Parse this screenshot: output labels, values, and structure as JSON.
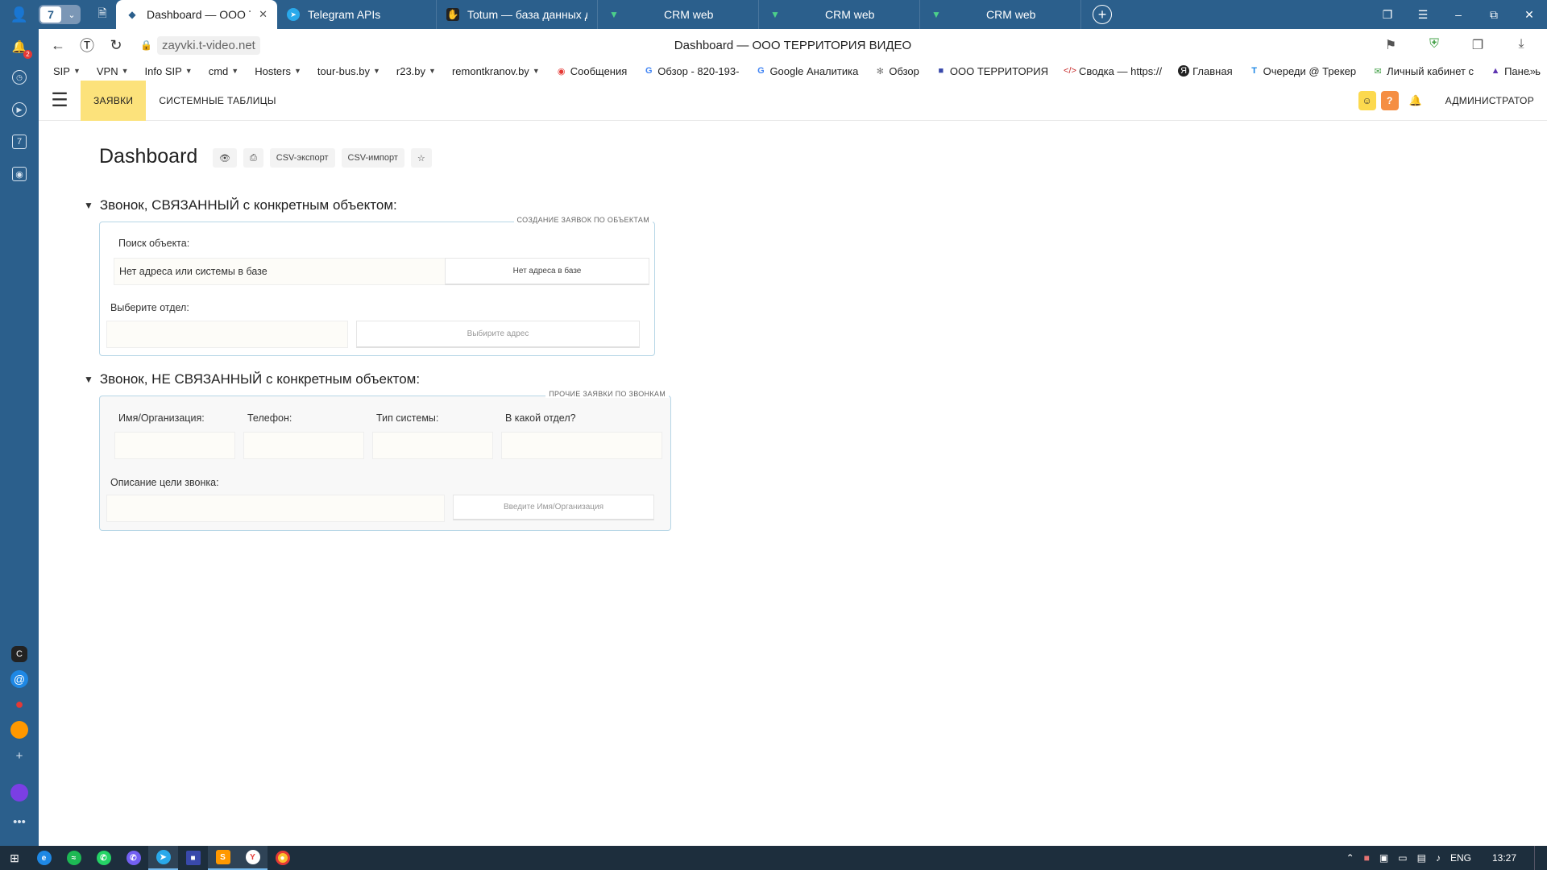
{
  "browser": {
    "tab_count": "7",
    "tabs": [
      {
        "label": "Dashboard — ООО ТЕРРИТОРИЯ ВИДЕО",
        "active": true
      },
      {
        "label": "Telegram APIs"
      },
      {
        "label": "Totum — база данных для бизнеса"
      },
      {
        "label": "CRM web"
      },
      {
        "label": "CRM web"
      },
      {
        "label": "CRM web"
      }
    ],
    "url": "zayvki.t-video.net",
    "page_title": "Dashboard — ООО ТЕРРИТОРИЯ ВИДЕО",
    "notification_count": "2",
    "sidebar_cal_day": "7",
    "sidebar_c_label": "C",
    "bookmarks": [
      {
        "label": "SIP",
        "dropdown": true
      },
      {
        "label": "VPN",
        "dropdown": true
      },
      {
        "label": "Info SIP",
        "dropdown": true
      },
      {
        "label": "cmd",
        "dropdown": true
      },
      {
        "label": "Hosters",
        "dropdown": true
      },
      {
        "label": "tour-bus.by",
        "dropdown": true
      },
      {
        "label": "r23.by",
        "dropdown": true
      },
      {
        "label": "remontkranov.by",
        "dropdown": true
      },
      {
        "label": "Сообщения",
        "icon": "mail-icon"
      },
      {
        "label": "Обзор - 820-193-",
        "icon": "google-icon"
      },
      {
        "label": "Google Аналитика",
        "icon": "google-icon"
      },
      {
        "label": "Обзор",
        "icon": "overview-icon"
      },
      {
        "label": "ООО ТЕРРИТОРИЯ",
        "icon": "company-icon"
      },
      {
        "label": "Сводка — https://",
        "icon": "code-icon"
      },
      {
        "label": "Главная",
        "icon": "yandex-icon"
      },
      {
        "label": "Очереди @ Трекер",
        "icon": "tracker-icon"
      },
      {
        "label": "Личный кабинет с",
        "icon": "envelope-icon"
      },
      {
        "label": "Панель",
        "icon": "panel-icon"
      }
    ],
    "bookmarks_more": "»"
  },
  "app": {
    "nav": [
      {
        "label": "ЗАЯВКИ",
        "active": true
      },
      {
        "label": "СИСТЕМНЫЕ ТАБЛИЦЫ"
      }
    ],
    "user_label": "АДМИНИСТРАТОР",
    "help_label": "?"
  },
  "page": {
    "title": "Dashboard",
    "toolbar": {
      "csv_export": "CSV-экспорт",
      "csv_import": "CSV-импорт",
      "star": "☆"
    }
  },
  "section1": {
    "heading": "Звонок, СВЯЗАННЫЙ с конкретным объектом:",
    "legend": "СОЗДАНИЕ ЗАЯВОК ПО ОБЪЕКТАМ",
    "search_label": "Поиск объекта:",
    "search_value": "Нет адреса или системы в базе",
    "search_button": "Нет адреса в базе",
    "dept_label": "Выберите отдел:",
    "dept_value": "",
    "address_button": "Выбирите адрес"
  },
  "section2": {
    "heading": "Звонок, НЕ СВЯЗАННЫЙ с конкретным объектом:",
    "legend": "ПРОЧИЕ ЗАЯВКИ ПО ЗВОНКАМ",
    "name_label": "Имя/Организация:",
    "phone_label": "Телефон:",
    "system_label": "Тип системы:",
    "dept_label": "В какой отдел?",
    "desc_label": "Описание цели звонка:",
    "submit_button": "Введите Имя/Организация"
  },
  "taskbar": {
    "lang": "ENG",
    "time": "13:27"
  },
  "colors": {
    "browser_chrome": "#2b5f8c",
    "active_nav": "#fce27b",
    "panel_border": "#b6d6e6",
    "user_btn": "#fcd94e",
    "help_btn": "#f58e43"
  }
}
